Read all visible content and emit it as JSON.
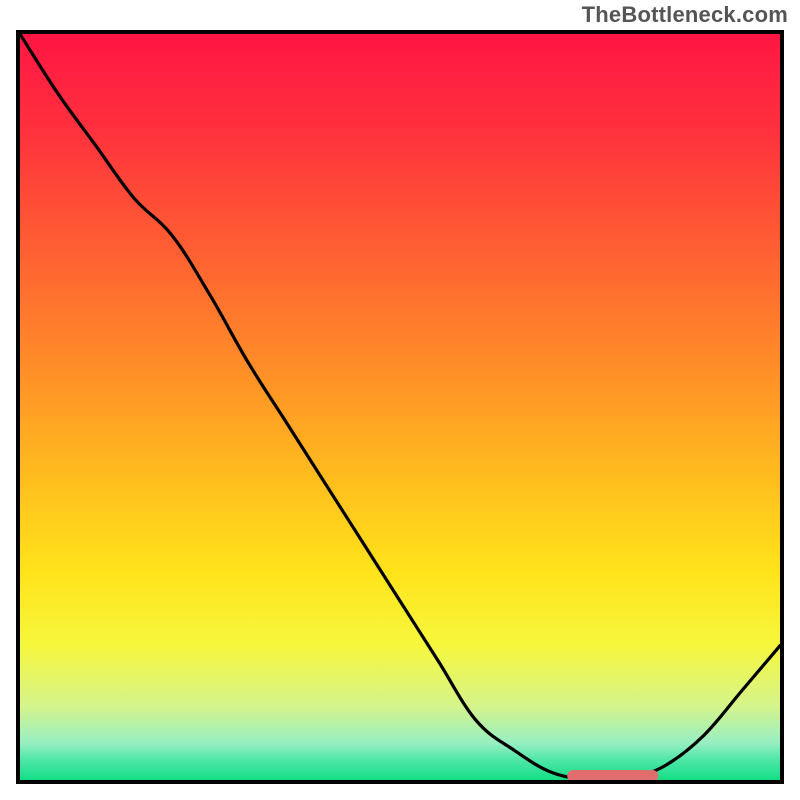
{
  "watermark": "TheBottleneck.com",
  "chart_data": {
    "type": "line",
    "title": "",
    "xlabel": "",
    "ylabel": "",
    "x": [
      0,
      5,
      10,
      15,
      20,
      25,
      30,
      35,
      40,
      45,
      50,
      55,
      60,
      65,
      70,
      75,
      78,
      80,
      85,
      90,
      95,
      100
    ],
    "values": [
      100,
      92,
      85,
      78,
      73,
      65,
      56,
      48,
      40,
      32,
      24,
      16,
      8,
      4,
      1,
      0,
      0,
      0,
      2,
      6,
      12,
      18
    ],
    "xlim": [
      0,
      100
    ],
    "ylim": [
      0,
      100
    ],
    "marker": {
      "x_start": 72,
      "x_end": 84,
      "y": 0
    },
    "gradient_stops": [
      {
        "offset": 0.0,
        "color": "#ff1643"
      },
      {
        "offset": 0.12,
        "color": "#ff2f3e"
      },
      {
        "offset": 0.28,
        "color": "#ff5c33"
      },
      {
        "offset": 0.44,
        "color": "#ff8b28"
      },
      {
        "offset": 0.58,
        "color": "#ffb81f"
      },
      {
        "offset": 0.72,
        "color": "#ffe31a"
      },
      {
        "offset": 0.82,
        "color": "#f6f73d"
      },
      {
        "offset": 0.9,
        "color": "#d6f48a"
      },
      {
        "offset": 0.95,
        "color": "#98efc2"
      },
      {
        "offset": 0.975,
        "color": "#49e6a5"
      },
      {
        "offset": 1.0,
        "color": "#13df85"
      }
    ],
    "curve_color": "#000000",
    "marker_color": "#e26d6d"
  }
}
